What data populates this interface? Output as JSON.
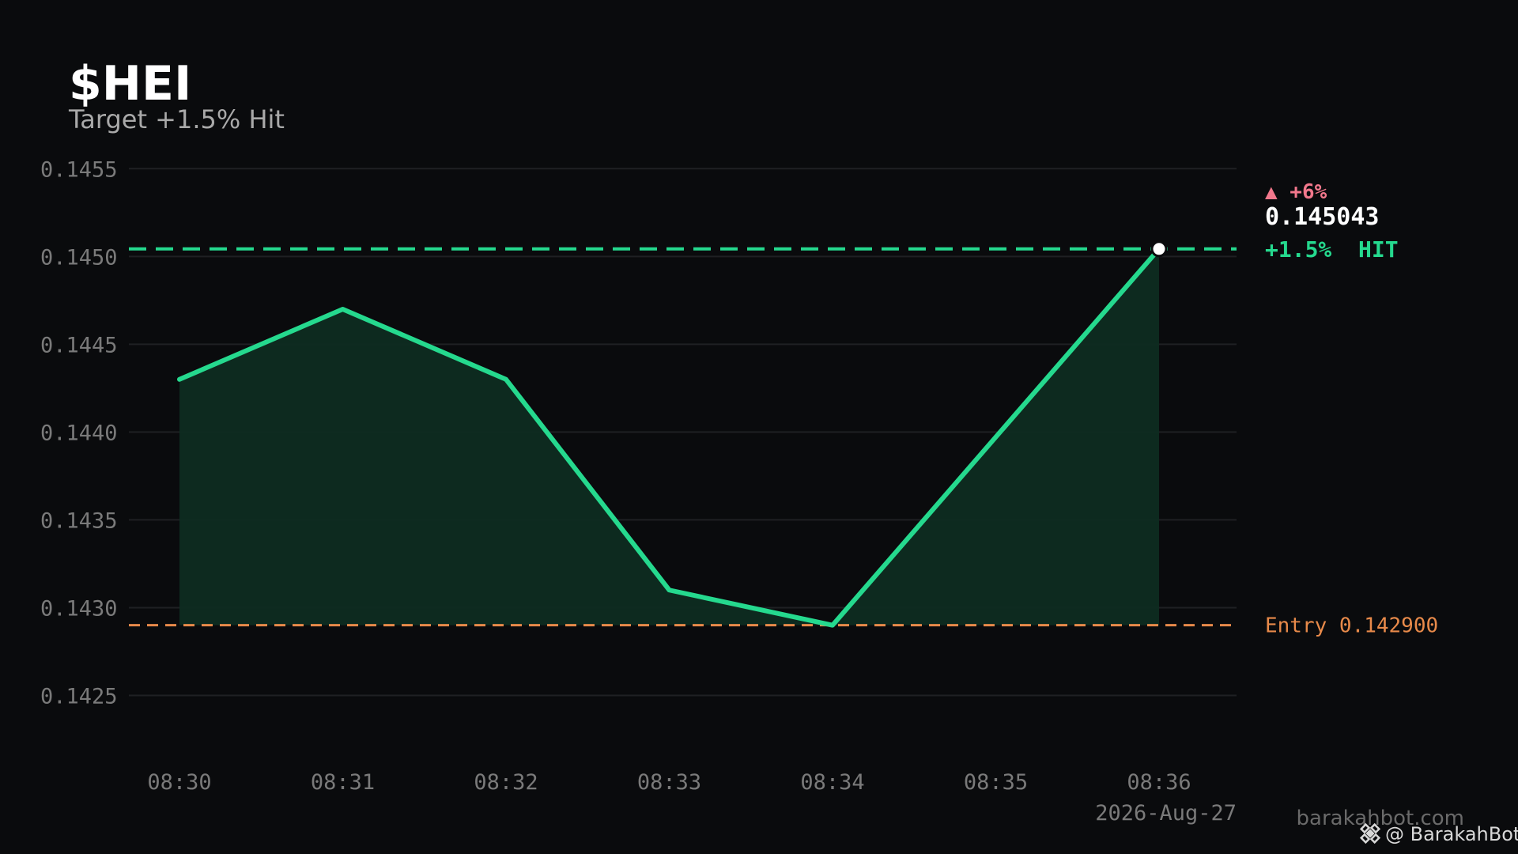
{
  "header": {
    "title": "$HEI",
    "subtitle": "Target +1.5% Hit"
  },
  "chart_data": {
    "type": "line",
    "categories": [
      "08:30",
      "08:31",
      "08:32",
      "08:33",
      "08:34",
      "08:35",
      "08:36"
    ],
    "x": [
      0,
      1,
      2,
      3,
      4,
      5,
      6
    ],
    "series": [
      {
        "x": [
          0,
          1,
          2,
          3,
          4,
          6
        ],
        "values": [
          0.1443,
          0.1447,
          0.1443,
          0.1431,
          0.1429,
          0.145043
        ]
      }
    ],
    "ylim": [
      0.14225,
      0.14565
    ],
    "yticks": [
      0.1455,
      0.145,
      0.1445,
      0.144,
      0.1435,
      0.143,
      0.1425
    ],
    "ytick_labels": [
      "0.1455",
      "0.1450",
      "0.1445",
      "0.1440",
      "0.1435",
      "0.1430",
      "0.1425"
    ],
    "grid": true,
    "date_label": "2026-Aug-27",
    "target_line": {
      "value": 0.145043,
      "price_label": "0.145043",
      "label": "+1.5%  HIT"
    },
    "entry_line": {
      "value": 0.1429,
      "label": "Entry 0.142900"
    },
    "peak_label": "▲ +6%",
    "colors": {
      "line": "#25d98e",
      "fill": "#0e2c21",
      "target": "#25d98e",
      "entry": "#e88a4a",
      "peak": "#f2788c",
      "grid": "#1f2023",
      "price": "#ffffff"
    }
  },
  "watermark": {
    "site": "barakahbot.com",
    "handle": "@ BarakahBot"
  }
}
